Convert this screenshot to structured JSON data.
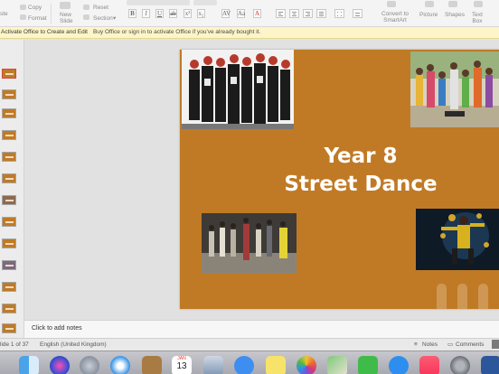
{
  "ribbon": {
    "paste_label": "ste",
    "copy_label": "Copy",
    "format_label": "Format",
    "new_slide_label": "New\nSlide",
    "reset_label": "Reset",
    "section_label": "Section",
    "convert_label": "Convert to\nSmartArt",
    "picture_label": "Picture",
    "shapes_label": "Shapes",
    "textbox_label": "Text\nBox"
  },
  "notification": {
    "title": "Activate Office to Create and Edit",
    "message": "Buy Office or sign in to activate Office if you've already bought it."
  },
  "slide": {
    "title_line1": "Year 8",
    "title_line2": "Street Dance",
    "background_color": "#c07a25"
  },
  "notes": {
    "placeholder": "Click to add notes"
  },
  "status": {
    "slide_info": "lide 1 of 37",
    "language": "English (United Kingdom)",
    "notes_label": "Notes",
    "comments_label": "Comments"
  },
  "dock": {
    "calendar_month": "JAN",
    "calendar_day": "13"
  }
}
